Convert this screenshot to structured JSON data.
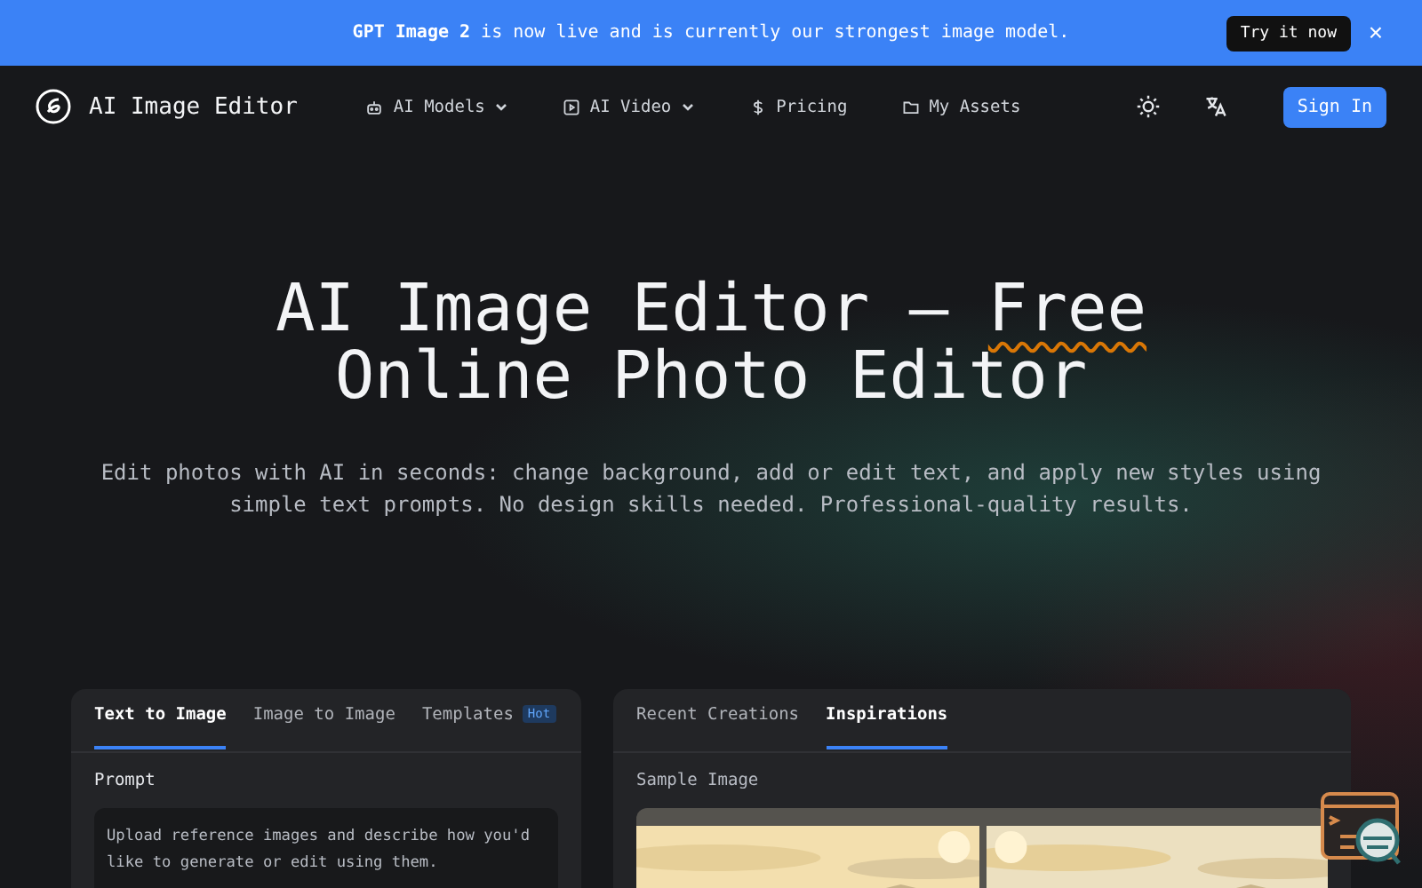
{
  "banner": {
    "text": "**GPT Image 2** is now live and is currently our strongest image model.",
    "button": "Try it now",
    "close": "×"
  },
  "nav": {
    "brand": "AI Image Editor",
    "items": [
      {
        "label": "AI Models",
        "dropdown": true
      },
      {
        "label": "AI Video",
        "dropdown": true
      },
      {
        "label": "Pricing",
        "dropdown": false
      },
      {
        "label": "My Assets",
        "dropdown": false
      }
    ],
    "sign_in": "Sign In"
  },
  "hero": {
    "title": [
      {
        "text": "AI Image Editor — ",
        "highlight": false
      },
      {
        "text": "Free",
        "highlight": true
      },
      {
        "text": " Online Photo Editor",
        "highlight": false
      }
    ],
    "subtitle": "Edit photos with AI in seconds: change background, add or edit text, and apply new styles using simple text prompts. No design skills needed. Professional-quality results."
  },
  "left_panel": {
    "tabs": [
      {
        "label": "Text to Image",
        "selected": true
      },
      {
        "label": "Image to Image",
        "selected": false
      },
      {
        "label": "Templates",
        "selected": false,
        "badge": "Hot"
      }
    ],
    "prompt_label": "Prompt",
    "prompt_placeholder": "Upload reference images and describe how you'd like to generate or edit using them."
  },
  "right_panel": {
    "tabs": [
      {
        "label": "Recent Creations",
        "selected": false
      },
      {
        "label": "Inspirations",
        "selected": true
      }
    ],
    "sample_label": "Sample Image"
  }
}
